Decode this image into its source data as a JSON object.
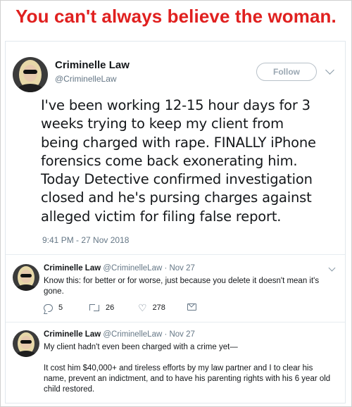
{
  "headline": "You can't always believe the woman.",
  "tweet": {
    "author_name": "Criminelle Law",
    "author_handle": "@CriminelleLaw",
    "follow_label": "Follow",
    "lines": [
      "I've been working 12-15 hour days for 3",
      "weeks trying to keep my client from",
      "being charged with rape. FINALLY iPhone",
      "forensics come back exonerating him.",
      "Today Detective confirmed investigation",
      "closed and he's pursing charges against",
      "alleged victim for filing false report."
    ],
    "timestamp": "9:41 PM - 27 Nov 2018"
  },
  "replies": [
    {
      "name": "Criminelle Law",
      "meta": "@CriminelleLaw · Nov 27",
      "lines": [
        "Know this: for better or for worse, just because you delete it doesn't mean it's",
        "gone."
      ],
      "reply_count": "5",
      "retweet_count": "26",
      "like_count": "278"
    },
    {
      "name": "Criminelle Law",
      "meta": "@CriminelleLaw · Nov 27",
      "lines": [
        "My client hadn't even been charged with a crime yet—",
        "",
        "It cost him $40,000+ and tireless efforts by my law partner and I to clear his",
        "name, prevent an indictment, and to have his parenting rights with his 6 year old",
        "child restored."
      ]
    }
  ],
  "colors": {
    "headline": "#e0201f",
    "secondary_text": "#657786",
    "divider": "#e6ecf0"
  },
  "icons": [
    "avatar",
    "chevron-down-icon",
    "reply-icon",
    "retweet-icon",
    "heart-icon",
    "direct-message-icon"
  ]
}
